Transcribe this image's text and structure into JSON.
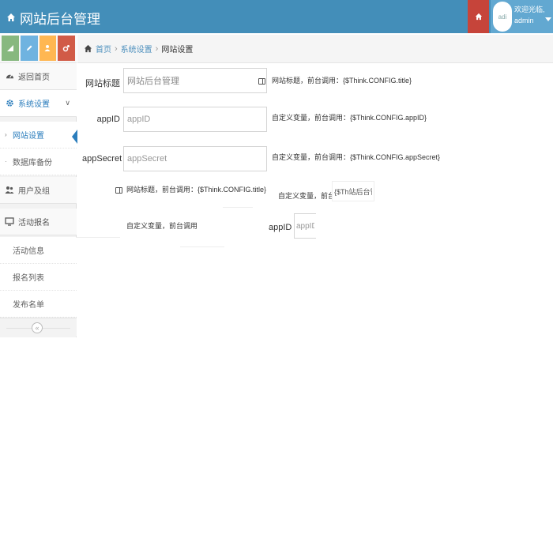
{
  "header": {
    "brand": "网站后台管理",
    "avatar_text": "adi",
    "welcome": "欢迎光临,",
    "username": "admin"
  },
  "breadcrumb": {
    "home": "首页",
    "section": "系统设置",
    "current": "网站设置"
  },
  "sidebar": {
    "items": [
      {
        "label": "返回首页",
        "icon": "dashboard-icon"
      },
      {
        "label": "系统设置",
        "icon": "gear-icon",
        "expanded": true
      },
      {
        "label": "网站设置"
      },
      {
        "label": "数据库备份"
      },
      {
        "label": "用户及组",
        "icon": "users-icon"
      },
      {
        "label": "活动报名",
        "icon": "desktop-icon"
      },
      {
        "label": "活动信息"
      },
      {
        "label": "报名列表"
      },
      {
        "label": "发布名单"
      }
    ]
  },
  "form": {
    "fields": [
      {
        "label": "网站标题",
        "value": "网站后台管理",
        "help": "网站标题，前台调用：{$Think.CONFIG.title}"
      },
      {
        "label": "appID",
        "placeholder": "appID",
        "help": "自定义变量，前台调用：{$Think.CONFIG.appID}"
      },
      {
        "label": "appSecret",
        "placeholder": "appSecret",
        "help": "自定义变量，前台调用：{$Think.CONFIG.appSecret}"
      }
    ],
    "overlay": {
      "help_title": "网站标题，前台调用：{$Think.CONFIG.title}",
      "help_custom": "自定义变量，前台调",
      "input_value": "{$Th站后台管理",
      "help_custom2": "自定义变量，前台调用",
      "label_appid": "appID",
      "placeholder_appid": "appID"
    }
  },
  "colors": {
    "header": "#438eb9",
    "home_button": "#c6443a",
    "user_area": "#62a8d1",
    "accent": "#2b7dbc"
  }
}
